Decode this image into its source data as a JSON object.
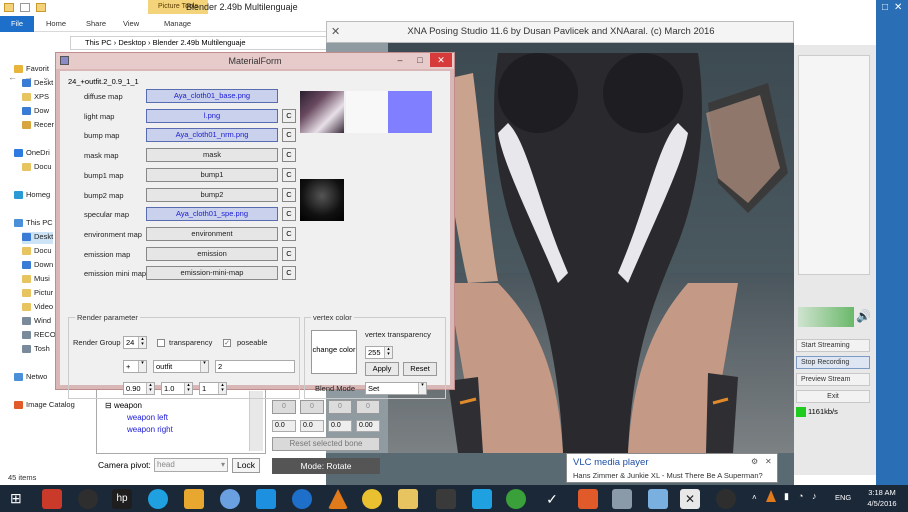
{
  "explorer": {
    "window_title": "Blender 2.49b Multilenguaje",
    "contextual_tab": "Picture Tools",
    "tabs": [
      "File",
      "Home",
      "Share",
      "View",
      "Manage"
    ],
    "address": [
      "This PC",
      "Desktop",
      "Blender 2.49b Multilenguaje"
    ],
    "nav": [
      "Favorit",
      "Deskt",
      "XPS",
      "Dow",
      "Recer",
      "OneDri",
      "Docu",
      "Homeg",
      "This PC",
      "Deskt",
      "Docu",
      "Down",
      "Musi",
      "Pictur",
      "Video",
      "Wind",
      "RECO",
      "Tosh",
      "Netwo",
      "Image Catalog"
    ],
    "status": "45 items"
  },
  "xna": {
    "title": "XNA Posing Studio 11.6 by Dusan Pavlicek and XNAaral. (c) March 2016",
    "tree": [
      "weapon",
      "weapon left",
      "weapon right"
    ],
    "camera_pivot_label": "Camera pivot:",
    "camera_pivot_value": "head",
    "lock_label": "Lock",
    "bone_fields": [
      "0.0",
      "0.0",
      "0.0",
      "0.00"
    ],
    "bone_buttons": [
      "0",
      "0",
      "0",
      "0"
    ],
    "reset_bone": "Reset selected bone",
    "mode": "Mode: Rotate"
  },
  "matform": {
    "title": "MaterialForm",
    "group_label": "24_+outfit.2_0.9_1_1",
    "maps": [
      {
        "label": "diffuse map",
        "value": "Aya_cloth01_base.png",
        "set": true,
        "has_c": false
      },
      {
        "label": "light map",
        "value": "l.png",
        "set": true,
        "has_c": true
      },
      {
        "label": "bump map",
        "value": "Aya_cloth01_nrm.png",
        "set": true,
        "has_c": true
      },
      {
        "label": "mask map",
        "value": "mask",
        "set": false,
        "has_c": true
      },
      {
        "label": "bump1 map",
        "value": "bump1",
        "set": false,
        "has_c": true
      },
      {
        "label": "bump2 map",
        "value": "bump2",
        "set": false,
        "has_c": true
      },
      {
        "label": "specular map",
        "value": "Aya_cloth01_spe.png",
        "set": true,
        "has_c": true
      },
      {
        "label": "environment map",
        "value": "environment",
        "set": false,
        "has_c": true
      },
      {
        "label": "emission map",
        "value": "emission",
        "set": false,
        "has_c": true
      },
      {
        "label": "emission mini map",
        "value": "emission-mini-map",
        "set": false,
        "has_c": true
      }
    ],
    "c_label": "C",
    "render": {
      "title": "Render parameter",
      "group_label": "Render Group",
      "group_value": "24",
      "transparency_label": "transparency",
      "transparency_checked": false,
      "poseable_label": "poseable",
      "poseable_checked": true,
      "op_value": "+",
      "param_name": "outfit",
      "param_value": "2",
      "v1": "0.90",
      "v2": "1.0",
      "v3": "1"
    },
    "vertex": {
      "title": "vertex color",
      "change_color": "change color",
      "transparency_label": "vertex transparency",
      "transparency_value": "255",
      "apply": "Apply",
      "reset": "Reset",
      "blend_label": "Blend Mode",
      "blend_value": "Set"
    }
  },
  "obs": {
    "start_streaming": "Start Streaming",
    "stop_recording": "Stop Recording",
    "preview_stream": "Preview Stream",
    "exit": "Exit",
    "kbs": "1161kb/s"
  },
  "notification": {
    "title": "VLC media player",
    "message": "Hans Zimmer & Junkie XL - Must There Be A Superman?"
  },
  "taskbar": {
    "lang": "ENG",
    "time": "3:18 AM",
    "date": "4/5/2016"
  },
  "colors": {
    "accent": "#1e6fc9",
    "taskbar": "#1b2838",
    "matform_border": "#d9b7b7",
    "set_texture": "#1a1ad4"
  }
}
